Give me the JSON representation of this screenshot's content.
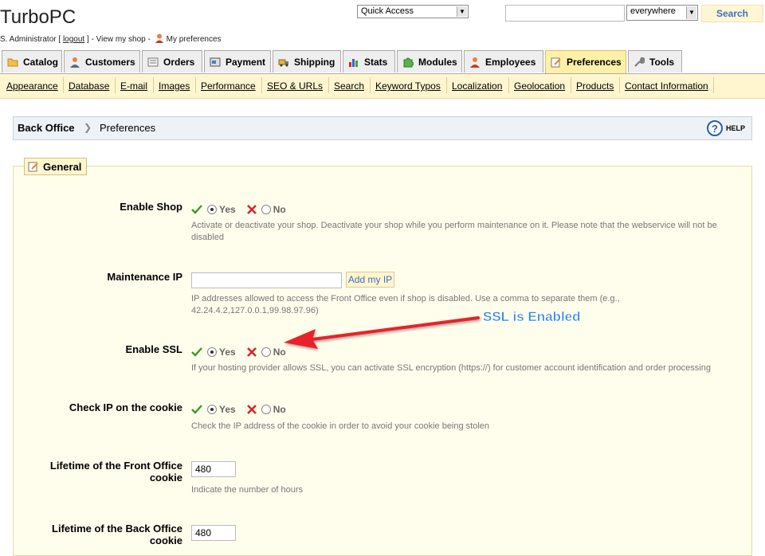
{
  "header": {
    "shop_name": "TurboPC",
    "user": "S. Administrator",
    "logout": "logout",
    "view_shop": "View my shop",
    "my_preferences": "My preferences",
    "quick_access": "Quick Access",
    "search_scope": "everywhere",
    "search_button": "Search"
  },
  "tabs": [
    {
      "label": "Catalog",
      "icon": "folder-icon"
    },
    {
      "label": "Customers",
      "icon": "person-icon"
    },
    {
      "label": "Orders",
      "icon": "orders-icon"
    },
    {
      "label": "Payment",
      "icon": "payment-icon"
    },
    {
      "label": "Shipping",
      "icon": "truck-icon"
    },
    {
      "label": "Stats",
      "icon": "chart-icon"
    },
    {
      "label": "Modules",
      "icon": "puzzle-icon"
    },
    {
      "label": "Employees",
      "icon": "person-icon"
    },
    {
      "label": "Preferences",
      "icon": "preferences-icon",
      "active": true
    },
    {
      "label": "Tools",
      "icon": "wrench-icon"
    }
  ],
  "subtabs": [
    "Appearance",
    "Database",
    "E-mail",
    "Images",
    "Performance",
    "SEO & URLs",
    "Search",
    "Keyword Typos",
    "Localization",
    "Geolocation",
    "Products",
    "Contact Information"
  ],
  "breadcrumb": {
    "root": "Back Office",
    "current": "Preferences",
    "help": "HELP"
  },
  "section": {
    "title": "General"
  },
  "fields": {
    "enable_shop": {
      "label": "Enable Shop",
      "yes": "Yes",
      "no": "No",
      "desc1": "Activate or deactivate your shop. Deactivate your shop while you perform maintenance on it. Please note that the webservice will not be",
      "desc2": "disabled"
    },
    "maintenance_ip": {
      "label": "Maintenance IP",
      "value": "",
      "button": "Add my IP",
      "desc1": "IP addresses allowed to access the Front Office even if shop is disabled. Use a comma to separate them (e.g.,",
      "desc2": "42.24.4.2,127.0.0.1,99.98.97.96)"
    },
    "enable_ssl": {
      "label": "Enable SSL",
      "yes": "Yes",
      "no": "No",
      "desc": "If your hosting provider allows SSL, you can activate SSL encryption (https://) for customer account identification and order processing"
    },
    "check_ip_cookie": {
      "label": "Check IP on the cookie",
      "yes": "Yes",
      "no": "No",
      "desc": "Check the IP address of the cookie in order to avoid your cookie being stolen"
    },
    "front_cookie": {
      "label1": "Lifetime of the Front Office",
      "label2": "cookie",
      "value": "480",
      "desc": "Indicate the number of hours"
    },
    "back_cookie": {
      "label1": "Lifetime of the Back Office",
      "label2": "cookie",
      "value": "480"
    }
  },
  "annotation": {
    "text": "SSL is Enabled",
    "color": "#2e8ae6",
    "arrow_color": "#e8202a"
  },
  "colors": {
    "active_tab": "#fff0a8",
    "subtab_bar": "#fff6cf",
    "panel": "#fffeec"
  }
}
